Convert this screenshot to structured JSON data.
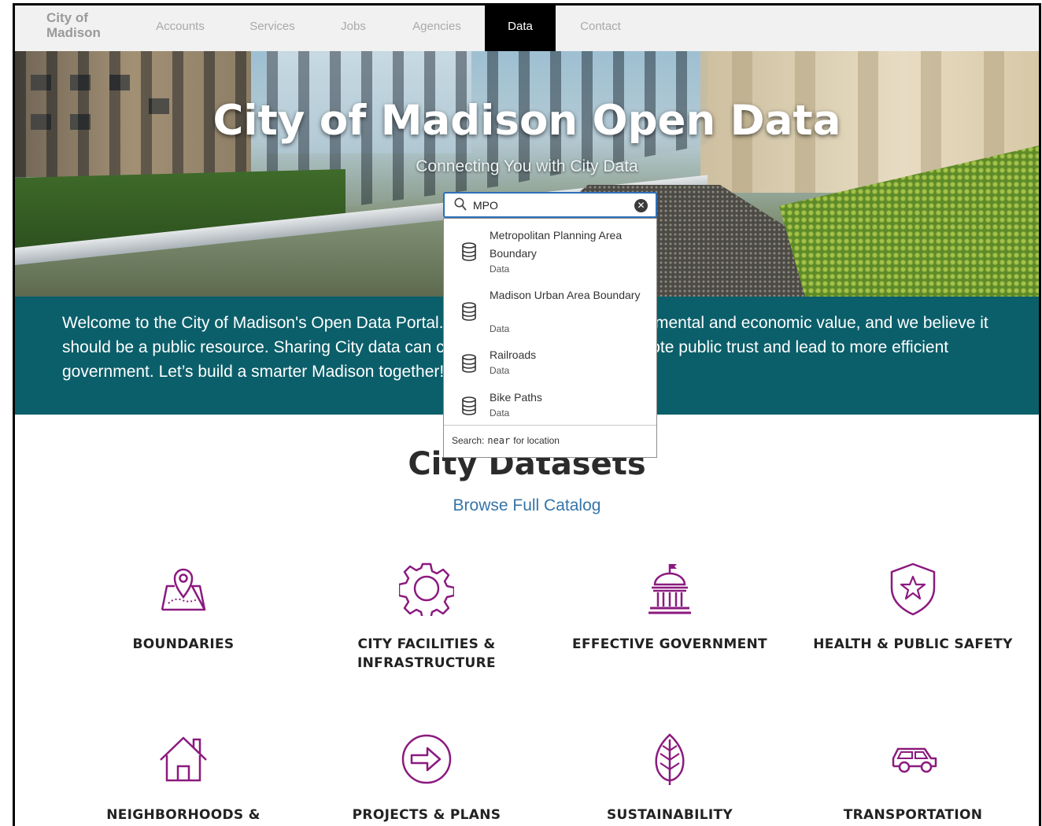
{
  "nav": {
    "logo": "City of Madison",
    "items": [
      {
        "label": "Accounts",
        "active": false
      },
      {
        "label": "Services",
        "active": false
      },
      {
        "label": "Jobs",
        "active": false
      },
      {
        "label": "Agencies",
        "active": false
      },
      {
        "label": "Data",
        "active": true
      },
      {
        "label": "Contact",
        "active": false
      }
    ]
  },
  "hero": {
    "title": "City of Madison Open Data",
    "subtitle": "Connecting You with City Data"
  },
  "search": {
    "value": "MPO",
    "results": [
      {
        "title": "Metropolitan Planning Area Boundary",
        "type": "Data",
        "icon": "database-icon"
      },
      {
        "title": "Madison Urban Area Boundary",
        "type": "Data",
        "icon": "database-icon"
      },
      {
        "title": "Railroads",
        "type": "Data",
        "icon": "database-icon"
      },
      {
        "title": "Bike Paths",
        "type": "Data",
        "icon": "database-icon"
      }
    ],
    "footer": {
      "prefix": "Search:",
      "keyword": "near",
      "suffix": "for location"
    }
  },
  "welcome": {
    "text": "Welcome to the City of Madison's Open Data Portal. City data has social, environmental and economic value, and we believe it should be a public resource. Sharing City data can create new businesses, promote public trust and lead to more efficient government. Let’s build a smarter Madison together!"
  },
  "datasets": {
    "title": "City Datasets",
    "link": "Browse Full Catalog",
    "categories": [
      {
        "label": "BOUNDARIES",
        "icon": "map-pin-icon"
      },
      {
        "label": "CITY FACILITIES & INFRASTRUCTURE",
        "icon": "gear-icon"
      },
      {
        "label": "EFFECTIVE GOVERNMENT",
        "icon": "capitol-icon"
      },
      {
        "label": "HEALTH & PUBLIC SAFETY",
        "icon": "shield-star-icon"
      },
      {
        "label": "NEIGHBORHOODS & PROPERTY",
        "icon": "house-icon"
      },
      {
        "label": "PROJECTS & PLANS",
        "icon": "arrow-circle-icon"
      },
      {
        "label": "SUSTAINABILITY",
        "icon": "leaf-icon"
      },
      {
        "label": "TRANSPORTATION",
        "icon": "car-icon"
      }
    ]
  },
  "colors": {
    "accent_teal": "#0b5f6a",
    "icon_purple": "#8b1a7f",
    "link_blue": "#3674a8"
  }
}
